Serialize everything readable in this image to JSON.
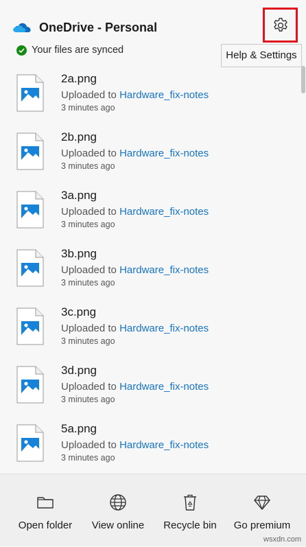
{
  "header": {
    "title": "OneDrive - Personal",
    "logo_icon": "onedrive-cloud-icon",
    "settings_icon": "gear-icon",
    "tooltip": "Help & Settings",
    "sync_status": "Your files are synced",
    "accent_color": "#0f6cbd",
    "highlight_color": "#e0141d"
  },
  "files": [
    {
      "name": "2a.png",
      "status_prefix": "Uploaded to",
      "folder": "Hardware_fix-notes",
      "time": "3 minutes ago"
    },
    {
      "name": "2b.png",
      "status_prefix": "Uploaded to",
      "folder": "Hardware_fix-notes",
      "time": "3 minutes ago"
    },
    {
      "name": "3a.png",
      "status_prefix": "Uploaded to",
      "folder": "Hardware_fix-notes",
      "time": "3 minutes ago"
    },
    {
      "name": "3b.png",
      "status_prefix": "Uploaded to",
      "folder": "Hardware_fix-notes",
      "time": "3 minutes ago"
    },
    {
      "name": "3c.png",
      "status_prefix": "Uploaded to",
      "folder": "Hardware_fix-notes",
      "time": "3 minutes ago"
    },
    {
      "name": "3d.png",
      "status_prefix": "Uploaded to",
      "folder": "Hardware_fix-notes",
      "time": "3 minutes ago"
    },
    {
      "name": "5a.png",
      "status_prefix": "Uploaded to",
      "folder": "Hardware_fix-notes",
      "time": "3 minutes ago"
    }
  ],
  "footer": {
    "open_folder": "Open folder",
    "view_online": "View online",
    "recycle_bin": "Recycle bin",
    "go_premium": "Go premium"
  },
  "watermark": "wsxdn.com"
}
